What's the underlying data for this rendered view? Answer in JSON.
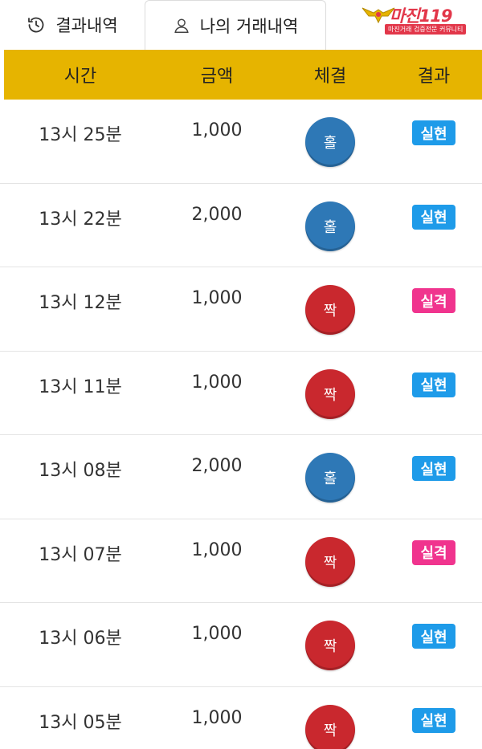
{
  "tabs": {
    "history_label": "결과내역",
    "mine_label": "나의 거래내역"
  },
  "logo": {
    "brand": "마진119",
    "tagline": "마진거래 검증전문 커뮤니티"
  },
  "colors": {
    "header_bg": "#e6b400",
    "odd_chip": "#2e78b6",
    "even_chip": "#c9282e",
    "win_badge": "#1e9be9",
    "lose_badge": "#f0348e"
  },
  "table": {
    "headers": [
      "시간",
      "금액",
      "체결",
      "결과"
    ],
    "rows": [
      {
        "time": "13시 25분",
        "amount": "1,000",
        "pick": "홀",
        "pick_type": "odd",
        "result": "실현",
        "result_type": "win"
      },
      {
        "time": "13시 22분",
        "amount": "2,000",
        "pick": "홀",
        "pick_type": "odd",
        "result": "실현",
        "result_type": "win"
      },
      {
        "time": "13시 12분",
        "amount": "1,000",
        "pick": "짝",
        "pick_type": "even",
        "result": "실격",
        "result_type": "lose"
      },
      {
        "time": "13시 11분",
        "amount": "1,000",
        "pick": "짝",
        "pick_type": "even",
        "result": "실현",
        "result_type": "win"
      },
      {
        "time": "13시 08분",
        "amount": "2,000",
        "pick": "홀",
        "pick_type": "odd",
        "result": "실현",
        "result_type": "win"
      },
      {
        "time": "13시 07분",
        "amount": "1,000",
        "pick": "짝",
        "pick_type": "even",
        "result": "실격",
        "result_type": "lose"
      },
      {
        "time": "13시 06분",
        "amount": "1,000",
        "pick": "짝",
        "pick_type": "even",
        "result": "실현",
        "result_type": "win"
      },
      {
        "time": "13시 05분",
        "amount": "1,000",
        "pick": "짝",
        "pick_type": "even",
        "result": "실현",
        "result_type": "win"
      }
    ]
  }
}
